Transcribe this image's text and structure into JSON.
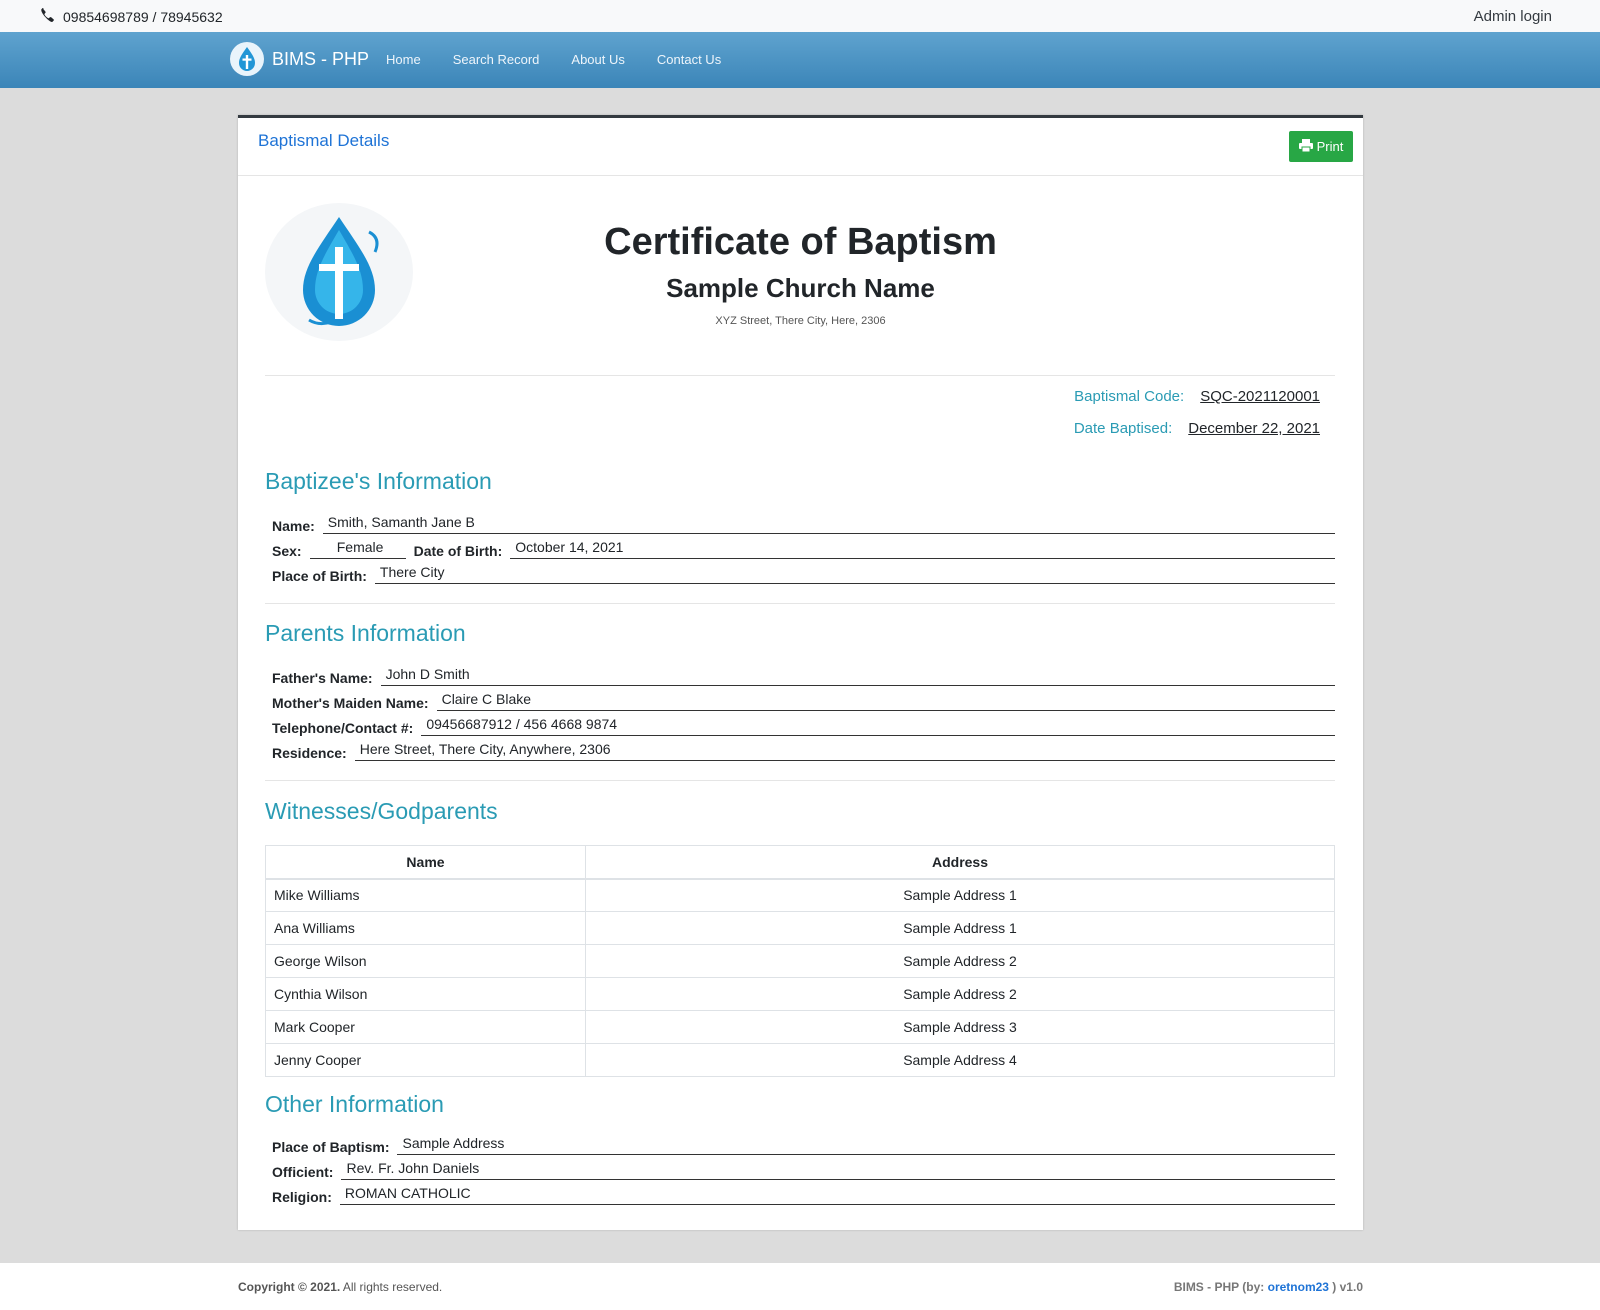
{
  "topbar": {
    "phone_icon": "phone-icon",
    "phones": "09854698789 / 78945632",
    "admin_login": "Admin login"
  },
  "navbar": {
    "brand": "BIMS - PHP",
    "links": [
      "Home",
      "Search Record",
      "About Us",
      "Contact Us"
    ]
  },
  "card": {
    "title": "Baptismal Details",
    "print_label": "Print",
    "print_icon": "printer-icon"
  },
  "certificate": {
    "title": "Certificate of Baptism",
    "church": "Sample Church Name",
    "address": "XYZ Street, There City, Here, 2306",
    "code_label": "Baptismal Code:",
    "code": "SQC-2021120001",
    "date_label": "Date Baptised:",
    "date": "December 22, 2021"
  },
  "baptizee": {
    "heading": "Baptizee's Information",
    "name_label": "Name:",
    "name": "Smith, Samanth Jane B",
    "sex_label": "Sex:",
    "sex": "Female",
    "dob_label": "Date of Birth:",
    "dob": "October 14, 2021",
    "pob_label": "Place of Birth:",
    "pob": "There City"
  },
  "parents": {
    "heading": "Parents Information",
    "father_label": "Father's Name:",
    "father": "John D Smith",
    "mother_label": "Mother's Maiden Name:",
    "mother": "Claire C Blake",
    "contact_label": "Telephone/Contact #:",
    "contact": "09456687912 / 456 4668 9874",
    "residence_label": "Residence:",
    "residence": "Here Street, There City, Anywhere, 2306"
  },
  "witnesses": {
    "heading": "Witnesses/Godparents",
    "columns": [
      "Name",
      "Address"
    ],
    "rows": [
      {
        "name": "Mike Williams",
        "address": "Sample Address 1"
      },
      {
        "name": "Ana Williams",
        "address": "Sample Address 1"
      },
      {
        "name": "George Wilson",
        "address": "Sample Address 2"
      },
      {
        "name": "Cynthia Wilson",
        "address": "Sample Address 2"
      },
      {
        "name": "Mark Cooper",
        "address": "Sample Address 3"
      },
      {
        "name": "Jenny Cooper",
        "address": "Sample Address 4"
      }
    ]
  },
  "other": {
    "heading": "Other Information",
    "place_label": "Place of Baptism:",
    "place": "Sample Address",
    "officient_label": "Officient:",
    "officient": "Rev. Fr. John Daniels",
    "religion_label": "Religion:",
    "religion": "ROMAN CATHOLIC"
  },
  "footer": {
    "copyright": "Copyright © 2021.",
    "rights": " All rights reserved.",
    "app": "BIMS - PHP (by: ",
    "author": "oretnom23",
    "version": " ) v1.0"
  },
  "colors": {
    "accent": "#2a9bb4",
    "link": "#1e73d6",
    "navbar": "#4a94c4",
    "print": "#28a745"
  }
}
